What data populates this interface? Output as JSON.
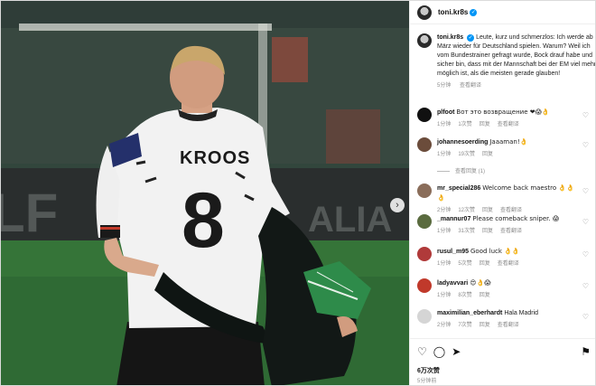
{
  "header": {
    "username": "toni.kr8s",
    "verified_mark": "✓"
  },
  "caption": {
    "username": "toni.kr8s",
    "text": "Leute, kurz und schmerzlos: Ich werde ab März wieder für Deutschland spielen. Warum? Weil ich vom Bundestrainer gefragt wurde, Bock drauf habe und sicher bin, dass mit der Mannschaft bei der EM viel mehr möglich ist, als die meisten gerade glauben!",
    "time": "5分钟",
    "translate": "查看翻译"
  },
  "jersey": {
    "name": "KROOS",
    "number": "8"
  },
  "comments": [
    {
      "username": "plfoot",
      "text": "Вот это возвращение ❤😱👌",
      "time": "1分钟",
      "likes": "1次赞",
      "reply": "回复",
      "translate": "查看翻译",
      "avatar_color": "#111111"
    },
    {
      "username": "johannesoerding",
      "text": "Jaaaman!👌",
      "time": "1分钟",
      "likes": "19次赞",
      "reply": "回复",
      "translate": "",
      "avatar_color": "#6b4c3b"
    },
    {
      "username": "mr_special286",
      "text": "Welcome back maestro 👌👌👌",
      "time": "2分钟",
      "likes": "12次赞",
      "reply": "回复",
      "translate": "查看翻译",
      "avatar_color": "#8a6d5a"
    },
    {
      "username": "_mannur07",
      "text": "Please comeback sniper. 😱",
      "time": "1分钟",
      "likes": "31次赞",
      "reply": "回复",
      "translate": "查看翻译",
      "avatar_color": "#5a6b3f"
    },
    {
      "username": "rusul_m95",
      "text": "Good luck 👌👌",
      "time": "1分钟",
      "likes": "5次赞",
      "reply": "回复",
      "translate": "查看翻译",
      "avatar_color": "#b03a3a"
    },
    {
      "username": "ladyavvari",
      "text": "😍👌😱",
      "time": "1分钟",
      "likes": "8次赞",
      "reply": "回复",
      "translate": "",
      "avatar_color": "#c0392b"
    },
    {
      "username": "maximilian_eberhardt",
      "text": "Hala Madrid",
      "time": "2分钟",
      "likes": "7次赞",
      "reply": "回复",
      "translate": "查看翻译",
      "avatar_color": "#d5d5d5"
    }
  ],
  "replies_toggle": "查看回复 (1)",
  "actions": {
    "like_icon": "heart-icon",
    "comment_icon": "comment-icon",
    "share_icon": "send-icon",
    "save_icon": "bookmark-icon"
  },
  "likes_count": "6万次赞",
  "post_time": "5分钟前",
  "colors": {
    "verified": "#0095f6",
    "meta": "#8e8e8e"
  }
}
